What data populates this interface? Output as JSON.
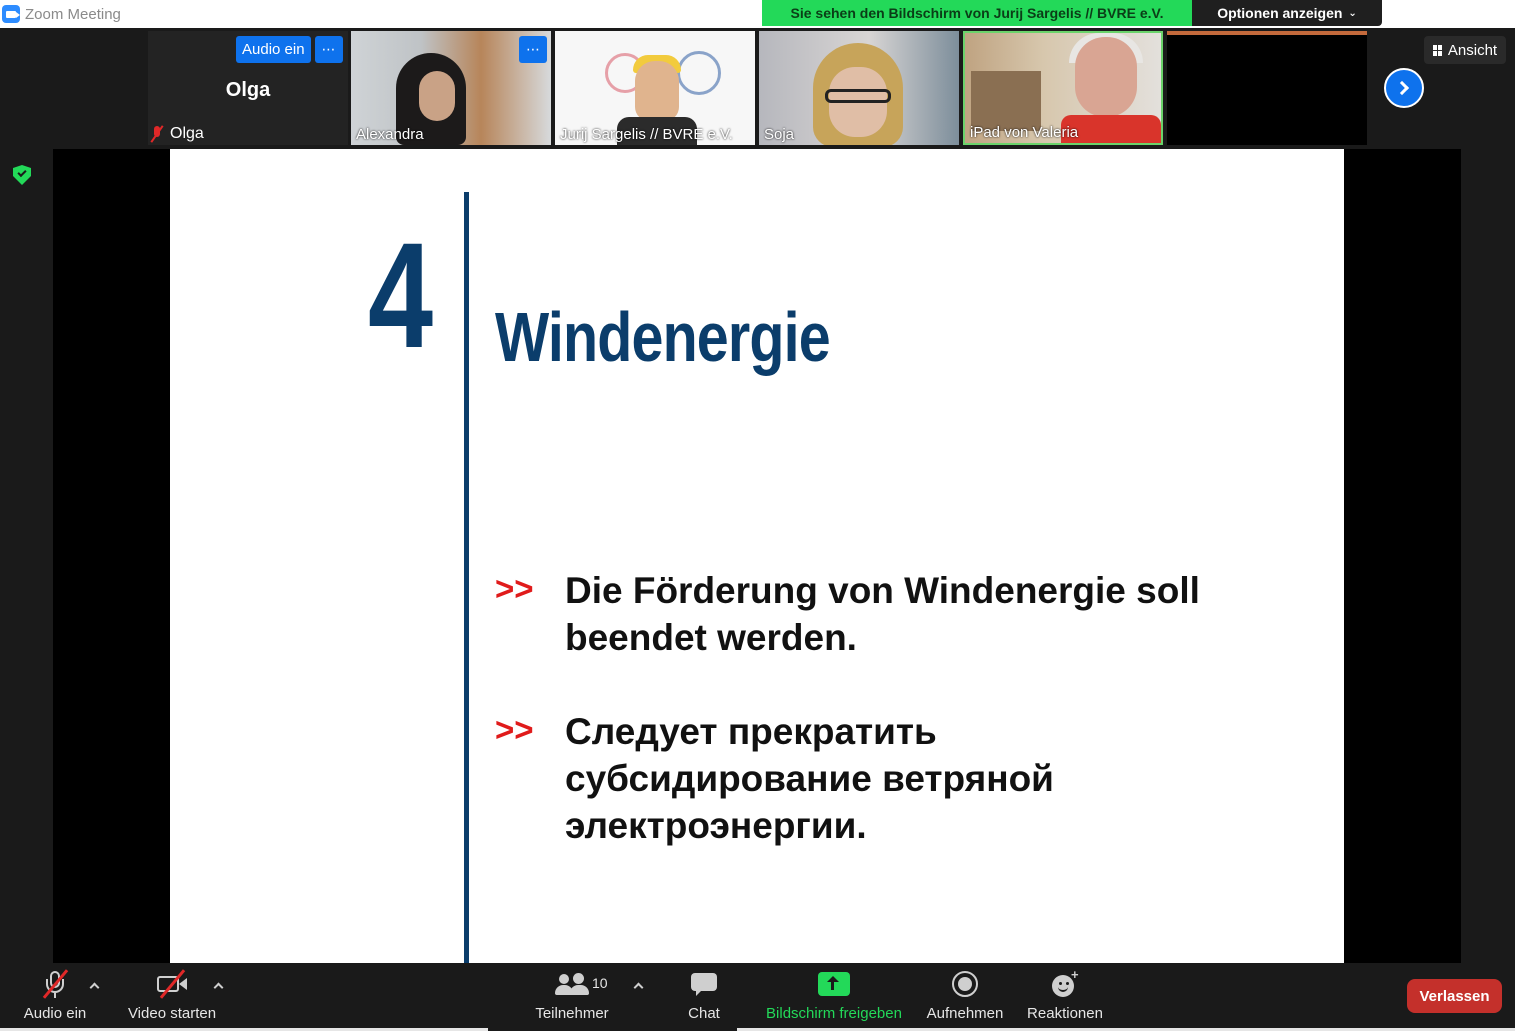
{
  "window": {
    "title": "Zoom Meeting"
  },
  "banner": {
    "share_text": "Sie sehen den Bildschirm von Jurij Sargelis // BVRE e.V.",
    "options_label": "Optionen anzeigen",
    "colors": {
      "banner": "#23d959",
      "options": "#1f1f1f"
    }
  },
  "gallery": {
    "view_label": "Ansicht",
    "tiles": [
      {
        "name": "Olga",
        "audio_button": "Audio ein",
        "muted": true
      },
      {
        "name": "Alexandra"
      },
      {
        "name": "Jurij Sargelis // BVRE e.V."
      },
      {
        "name": "Soja"
      },
      {
        "name": "iPad von Valeria",
        "active_speaker": true
      },
      {
        "name": ""
      }
    ]
  },
  "slide": {
    "number": "4",
    "title": "Windenergie",
    "bullets": [
      {
        "marker": ">>",
        "text": "Die Förderung von Windenergie soll beendet werden."
      },
      {
        "marker": ">>",
        "text": "Следует прекратить субсидирование ветряной электроэнергии."
      }
    ],
    "colors": {
      "primary": "#0b3d6b",
      "marker": "#e01b1b"
    }
  },
  "toolbar": {
    "audio_label": "Audio ein",
    "video_label": "Video starten",
    "participants_label": "Teilnehmer",
    "participants_count": "10",
    "chat_label": "Chat",
    "share_label": "Bildschirm freigeben",
    "record_label": "Aufnehmen",
    "reactions_label": "Reaktionen",
    "leave_label": "Verlassen",
    "colors": {
      "share": "#23d959",
      "leave": "#c4302b"
    }
  }
}
